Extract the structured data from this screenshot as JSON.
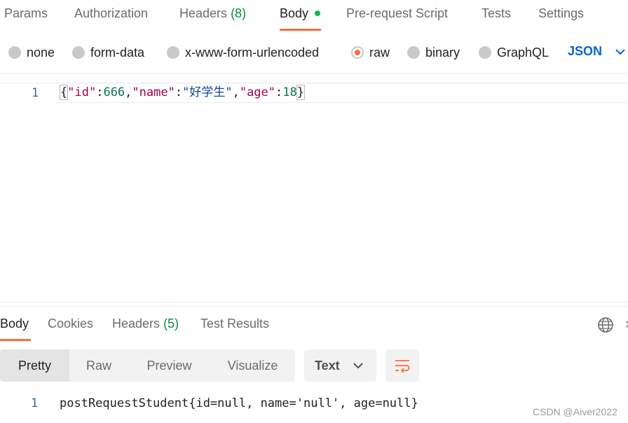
{
  "request_tabs": {
    "params": "Params",
    "authorization": "Authorization",
    "headers": "Headers",
    "headers_count": "(8)",
    "body": "Body",
    "prerequest": "Pre-request Script",
    "tests": "Tests",
    "settings": "Settings"
  },
  "body_types": {
    "none": "none",
    "form_data": "form-data",
    "urlencoded": "x-www-form-urlencoded",
    "raw": "raw",
    "binary": "binary",
    "graphql": "GraphQL",
    "selected": "raw",
    "language": "JSON"
  },
  "editor": {
    "line_number": "1",
    "tokens": {
      "open": "{",
      "k_id": "\"id\"",
      "colon1": ":",
      "v_id": "666",
      "comma1": ",",
      "k_name": "\"name\"",
      "colon2": ":",
      "v_name": "\"好学生\"",
      "comma2": ",",
      "k_age": "\"age\"",
      "colon3": ":",
      "v_age": "18",
      "close": "}"
    }
  },
  "response_tabs": {
    "body": "Body",
    "cookies": "Cookies",
    "headers": "Headers",
    "headers_count": "(5)",
    "test_results": "Test Results"
  },
  "view_modes": {
    "pretty": "Pretty",
    "raw": "Raw",
    "preview": "Preview",
    "visualize": "Visualize",
    "selected": "Pretty"
  },
  "format": {
    "label": "Text"
  },
  "response": {
    "line_number": "1",
    "text": "postRequestStudent{id=null, name='null', age=null}"
  },
  "watermark": "CSDN @Aiver2022",
  "colors": {
    "accent": "#ff6c37",
    "status_green": "#0cbb52",
    "link_blue": "#0265d2"
  },
  "icons": {
    "globe": "globe-icon",
    "wrap": "wrap-lines-icon",
    "chevron": "chevron-down-icon"
  }
}
